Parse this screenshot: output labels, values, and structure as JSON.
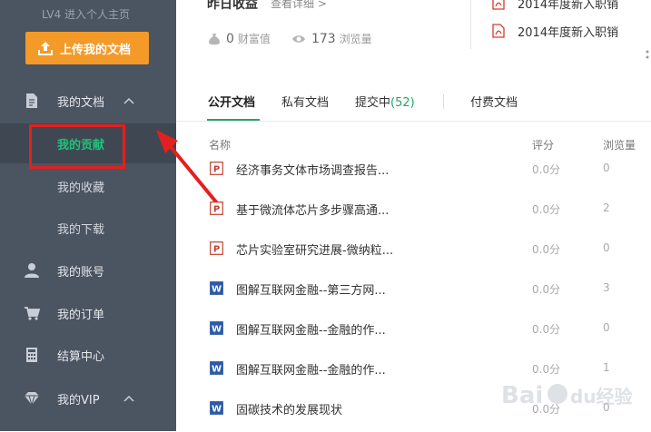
{
  "sidebar": {
    "level_link": "LV4  进入个人主页",
    "upload_label": "上传我的文档",
    "items": [
      {
        "label": "我的文档"
      },
      {
        "label": "我的贡献"
      },
      {
        "label": "我的收藏"
      },
      {
        "label": "我的下载"
      },
      {
        "label": "我的账号"
      },
      {
        "label": "我的订单"
      },
      {
        "label": "结算中心"
      },
      {
        "label": "我的VIP"
      }
    ]
  },
  "top": {
    "title": "昨日收益",
    "detail_link": "查看详细 >",
    "wealth_value": "0",
    "wealth_label": "财富值",
    "views_value": "173",
    "views_label": "浏览量",
    "recent_docs": [
      "2014年度新入职销",
      "2014年度新入职销"
    ]
  },
  "tabs": {
    "public": "公开文档",
    "private": "私有文档",
    "submitting": "提交中",
    "submitting_count": "(52)",
    "paid": "付费文档"
  },
  "table": {
    "headers": {
      "name": "名称",
      "score": "评分",
      "views": "浏览量"
    },
    "rows": [
      {
        "type": "ppt",
        "name": "经济事务文体市场调查报告...",
        "score": "0.0分",
        "views": "0"
      },
      {
        "type": "ppt",
        "name": "基于微流体芯片多步骤高通...",
        "score": "0.0分",
        "views": "2"
      },
      {
        "type": "ppt",
        "name": "芯片实验室研究进展-微纳粒...",
        "score": "0.0分",
        "views": "0"
      },
      {
        "type": "word",
        "name": "图解互联网金融--第三方网...",
        "score": "0.0分",
        "views": "3"
      },
      {
        "type": "word",
        "name": "图解互联网金融--金融的作...",
        "score": "0.0分",
        "views": "0"
      },
      {
        "type": "word",
        "name": "图解互联网金融--金融的作...",
        "score": "0.0分",
        "views": "1"
      },
      {
        "type": "word",
        "name": "固碳技术的发展现状",
        "score": "0.0分",
        "views": "0"
      }
    ]
  },
  "watermark": "Baidu经验",
  "colors": {
    "sidebar_bg": "#4b5461",
    "accent_green": "#21a865",
    "upload_orange": "#f39a29",
    "annotation_red": "#e41f1f"
  }
}
